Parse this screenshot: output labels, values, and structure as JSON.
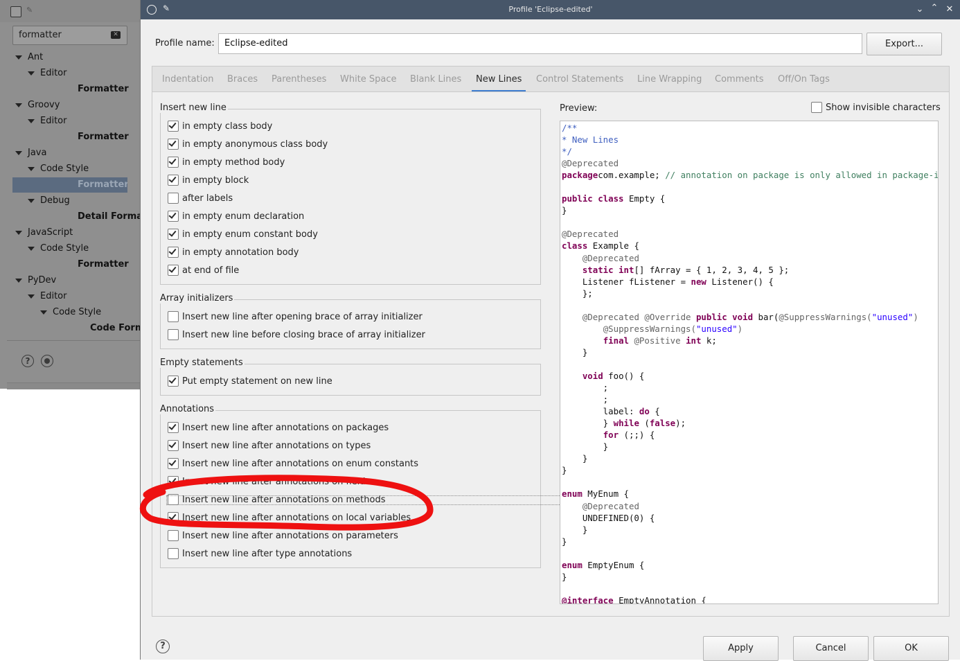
{
  "background_window": {
    "filter_value": "formatter",
    "tree": [
      {
        "label": "Ant",
        "level": 0,
        "expanded": true
      },
      {
        "label": "Editor",
        "level": 1,
        "expanded": true
      },
      {
        "label": "Formatter",
        "level": 2,
        "leaf": true
      },
      {
        "label": "Groovy",
        "level": 0,
        "expanded": true
      },
      {
        "label": "Editor",
        "level": 1,
        "expanded": true
      },
      {
        "label": "Formatter",
        "level": 2,
        "leaf": true
      },
      {
        "label": "Java",
        "level": 0,
        "expanded": true
      },
      {
        "label": "Code Style",
        "level": 1,
        "expanded": true
      },
      {
        "label": "Formatter",
        "level": 2,
        "leaf": true,
        "selected": true
      },
      {
        "label": "Debug",
        "level": 1,
        "expanded": true
      },
      {
        "label": "Detail Formatters",
        "level": 2,
        "leaf": true
      },
      {
        "label": "JavaScript",
        "level": 0,
        "expanded": true
      },
      {
        "label": "Code Style",
        "level": 1,
        "expanded": true
      },
      {
        "label": "Formatter",
        "level": 2,
        "leaf": true
      },
      {
        "label": "PyDev",
        "level": 0,
        "expanded": true
      },
      {
        "label": "Editor",
        "level": 1,
        "expanded": true
      },
      {
        "label": "Code Style",
        "level": 2,
        "expanded": true
      },
      {
        "label": "Code Formatter",
        "level": 3,
        "leaf": true
      }
    ],
    "help_glyph": "?"
  },
  "dialog": {
    "title": "Profile 'Eclipse-edited'",
    "window_icons": {
      "minimize": "chevron-down-icon",
      "maximize": "chevron-up-icon",
      "close": "close-icon"
    },
    "profile_name_label": "Profile name:",
    "profile_name_value": "Eclipse-edited",
    "export_label": "Export...",
    "tabs": [
      "Indentation",
      "Braces",
      "Parentheses",
      "White Space",
      "Blank Lines",
      "New Lines",
      "Control Statements",
      "Line Wrapping",
      "Comments",
      "Off/On Tags"
    ],
    "active_tab": "New Lines",
    "groups": [
      {
        "title": "Insert new line",
        "options": [
          {
            "label": "in empty class body",
            "checked": true
          },
          {
            "label": "in empty anonymous class body",
            "checked": true
          },
          {
            "label": "in empty method body",
            "checked": true
          },
          {
            "label": "in empty block",
            "checked": true
          },
          {
            "label": "after labels",
            "checked": false
          },
          {
            "label": "in empty enum declaration",
            "checked": true
          },
          {
            "label": "in empty enum constant body",
            "checked": true
          },
          {
            "label": "in empty annotation body",
            "checked": true
          },
          {
            "label": "at end of file",
            "checked": true
          }
        ]
      },
      {
        "title": "Array initializers",
        "options": [
          {
            "label": "Insert new line after opening brace of array initializer",
            "checked": false
          },
          {
            "label": "Insert new line before closing brace of array initializer",
            "checked": false
          }
        ]
      },
      {
        "title": "Empty statements",
        "options": [
          {
            "label": "Put empty statement on new line",
            "checked": true
          }
        ]
      },
      {
        "title": "Annotations",
        "options": [
          {
            "label": "Insert new line after annotations on packages",
            "checked": true
          },
          {
            "label": "Insert new line after annotations on types",
            "checked": true
          },
          {
            "label": "Insert new line after annotations on enum constants",
            "checked": true
          },
          {
            "label": "Insert new line after annotations on fields",
            "checked": true
          },
          {
            "label": "Insert new line after annotations on methods",
            "checked": false
          },
          {
            "label": "Insert new line after annotations on local variables",
            "checked": true
          },
          {
            "label": "Insert new line after annotations on parameters",
            "checked": false
          },
          {
            "label": "Insert new line after type annotations",
            "checked": false
          }
        ]
      }
    ],
    "preview_label": "Preview:",
    "show_invisible_label": "Show invisible characters",
    "show_invisible_checked": false,
    "preview_code": [
      [
        [
          "cj",
          "/**"
        ]
      ],
      [
        [
          "cj",
          "* New Lines"
        ]
      ],
      [
        [
          "cj",
          "*/"
        ]
      ],
      [
        [
          "ca",
          "@Deprecated"
        ]
      ],
      [
        [
          "ck",
          "package"
        ],
        [
          "",
          "com.example; "
        ],
        [
          "cc",
          "// annotation on package is only allowed in package-info.java"
        ]
      ],
      [],
      [
        [
          "ck",
          "public class"
        ],
        [
          "",
          " Empty {"
        ]
      ],
      [
        [
          "",
          "}"
        ]
      ],
      [],
      [
        [
          "ca",
          "@Deprecated"
        ]
      ],
      [
        [
          "ck",
          "class"
        ],
        [
          "",
          " Example {"
        ]
      ],
      [
        [
          "",
          "    "
        ],
        [
          "ca",
          "@Deprecated"
        ]
      ],
      [
        [
          "",
          "    "
        ],
        [
          "ck",
          "static int"
        ],
        [
          "",
          "[] fArray = { 1, 2, 3, 4, 5 };"
        ]
      ],
      [
        [
          "",
          "    Listener fListener = "
        ],
        [
          "ck",
          "new"
        ],
        [
          "",
          " Listener() {"
        ]
      ],
      [
        [
          "",
          "    };"
        ]
      ],
      [],
      [
        [
          "",
          "    "
        ],
        [
          "ca",
          "@Deprecated @Override"
        ],
        [
          "",
          " "
        ],
        [
          "ck",
          "public void"
        ],
        [
          "",
          " bar("
        ],
        [
          "ca",
          "@SuppressWarnings("
        ],
        [
          "cs",
          "\"unused\""
        ],
        [
          "ca",
          ")"
        ]
      ],
      [
        [
          "",
          "        "
        ],
        [
          "ca",
          "@SuppressWarnings("
        ],
        [
          "cs",
          "\"unused\""
        ],
        [
          "ca",
          ")"
        ]
      ],
      [
        [
          "",
          "        "
        ],
        [
          "ck",
          "final"
        ],
        [
          "",
          " "
        ],
        [
          "ca",
          "@Positive"
        ],
        [
          "",
          " "
        ],
        [
          "ck",
          "int"
        ],
        [
          "",
          " k;"
        ]
      ],
      [
        [
          "",
          "    }"
        ]
      ],
      [],
      [
        [
          "",
          "    "
        ],
        [
          "ck",
          "void"
        ],
        [
          "",
          " foo() {"
        ]
      ],
      [
        [
          "",
          "        ;"
        ]
      ],
      [
        [
          "",
          "        ;"
        ]
      ],
      [
        [
          "",
          "        label: "
        ],
        [
          "ck",
          "do"
        ],
        [
          "",
          " {"
        ]
      ],
      [
        [
          "",
          "        } "
        ],
        [
          "ck",
          "while"
        ],
        [
          "",
          " ("
        ],
        [
          "ck",
          "false"
        ],
        [
          "",
          ");"
        ]
      ],
      [
        [
          "",
          "        "
        ],
        [
          "ck",
          "for"
        ],
        [
          "",
          " (;;) {"
        ]
      ],
      [
        [
          "",
          "        }"
        ]
      ],
      [
        [
          "",
          "    }"
        ]
      ],
      [
        [
          "",
          "}"
        ]
      ],
      [],
      [
        [
          "ck",
          "enum"
        ],
        [
          "",
          " MyEnum {"
        ]
      ],
      [
        [
          "",
          "    "
        ],
        [
          "ca",
          "@Deprecated"
        ]
      ],
      [
        [
          "",
          "    UNDEFINED(0) {"
        ]
      ],
      [
        [
          "",
          "    }"
        ]
      ],
      [
        [
          "",
          "}"
        ]
      ],
      [],
      [
        [
          "ck",
          "enum"
        ],
        [
          "",
          " EmptyEnum {"
        ]
      ],
      [
        [
          "",
          "}"
        ]
      ],
      [],
      [
        [
          "ck",
          "@interface"
        ],
        [
          "",
          " EmptyAnnotation {"
        ]
      ]
    ],
    "help_glyph": "?",
    "apply_label": "Apply",
    "cancel_label": "Cancel",
    "ok_label": "OK"
  },
  "annotation_color": "#ee1111"
}
